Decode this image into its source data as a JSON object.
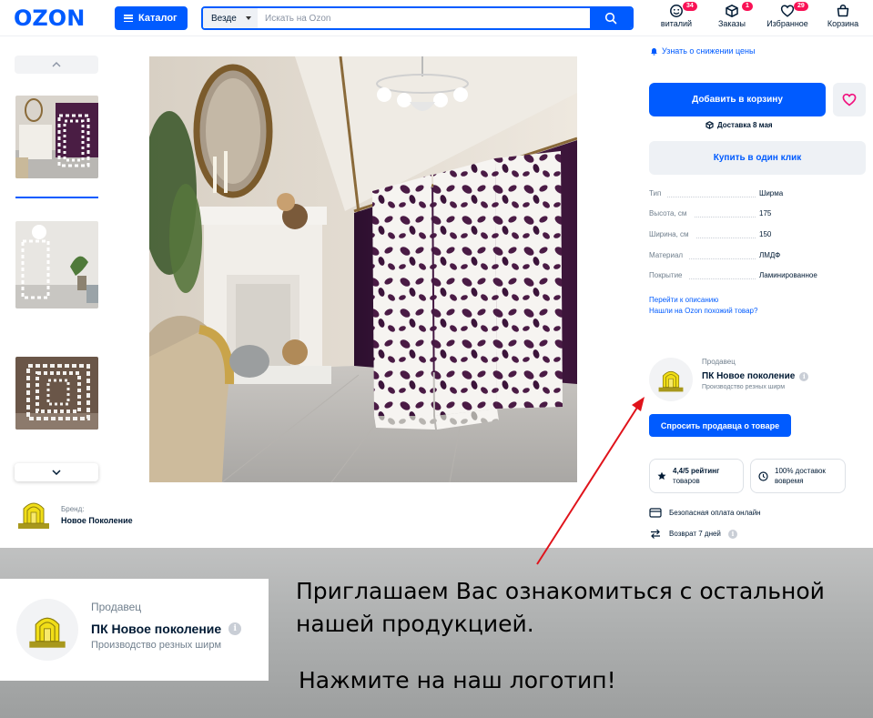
{
  "header": {
    "logo": "OZON",
    "catalog_label": "Каталог",
    "search_scope": "Везде",
    "search_placeholder": "Искать на Ozon",
    "icons": [
      {
        "name": "profile-icon",
        "label": "виталий",
        "badge": "34"
      },
      {
        "name": "orders-icon",
        "label": "Заказы",
        "badge": "1"
      },
      {
        "name": "favorites-icon",
        "label": "Избранное",
        "badge": "29"
      },
      {
        "name": "cart-icon",
        "label": "Корзина",
        "badge": ""
      }
    ]
  },
  "brand": {
    "caption": "Бренд:",
    "name": "Новое Поколение"
  },
  "product_panel": {
    "price_alert": "Узнать о снижении цены",
    "add_to_cart": "Добавить в корзину",
    "delivery": "Доставка 8 мая",
    "buy_one_click": "Купить в один клик",
    "specs": [
      {
        "key": "Тип",
        "value": "Ширма"
      },
      {
        "key": "Высота, см",
        "value": "175"
      },
      {
        "key": "Ширина, см",
        "value": "150"
      },
      {
        "key": "Материал",
        "value": "ЛМДФ"
      },
      {
        "key": "Покрытие",
        "value": "Ламинированное"
      }
    ],
    "link_description": "Перейти к описанию",
    "link_similar": "Нашли на Ozon похожий товар?"
  },
  "seller": {
    "caption": "Продавец",
    "name": "ПК Новое поколение",
    "subtitle": "Производство резных ширм",
    "ask_button": "Спросить продавца о товаре",
    "rating_line1": "4,4/5 рейтинг",
    "rating_line2": "товаров",
    "delivery_line1": "100% доставок",
    "delivery_line2": "вовремя",
    "safe_payment": "Безопасная оплата онлайн",
    "return_policy": "Возврат 7 дней"
  },
  "promo": {
    "seller_caption": "Продавец",
    "seller_name": "ПК Новое поколение",
    "seller_subtitle": "Производство резных ширм",
    "invite_line1": "Приглашаем Вас ознакомиться с остальной",
    "invite_line2": "нашей продукцией.",
    "cta": "Нажмите на наш логотип!"
  },
  "colors": {
    "brand": "#005bff",
    "badge": "#f91155",
    "favorite": "#f1117e",
    "arrow": "#e0131b"
  }
}
